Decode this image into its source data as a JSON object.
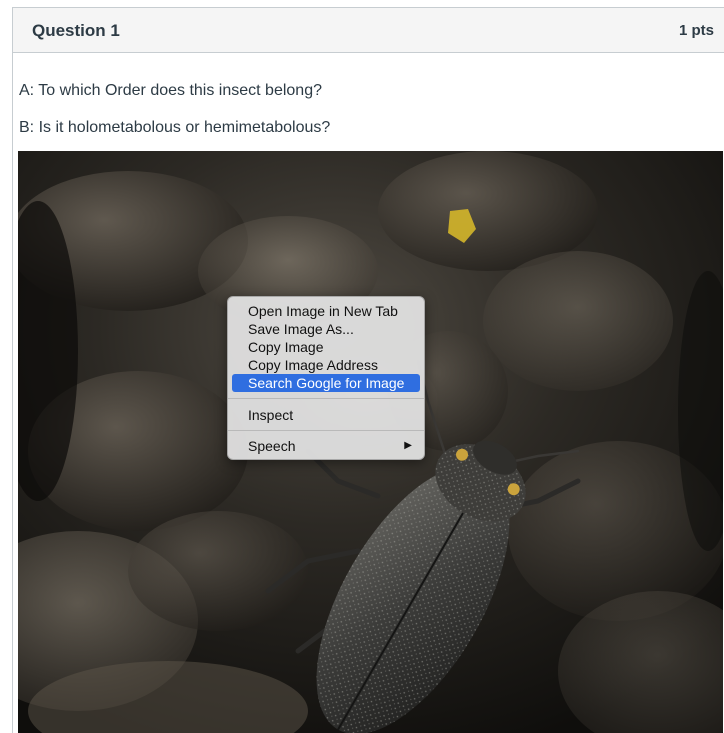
{
  "question": {
    "title": "Question 1",
    "points": "1 pts",
    "prompt_a": "A: To which Order does this insect belong?",
    "prompt_b": "B: Is it holometabolous or hemimetabolous?"
  },
  "context_menu": {
    "items": [
      {
        "label": "Open Image in New Tab"
      },
      {
        "label": "Save Image As..."
      },
      {
        "label": "Copy Image"
      },
      {
        "label": "Copy Image Address"
      },
      {
        "label": "Search Google for Image",
        "highlighted": true
      },
      {
        "label": "Inspect"
      },
      {
        "label": "Speech",
        "submenu_icon": "right-triangle-icon"
      }
    ]
  },
  "colors": {
    "text": "#2d3b45",
    "header_bg": "#f5f5f5",
    "menu_highlight": "#2f6ee0"
  }
}
